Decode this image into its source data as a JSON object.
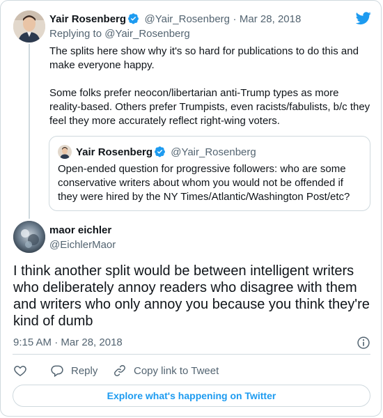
{
  "colors": {
    "accent": "#1d9bf0",
    "text": "#0f1419",
    "muted": "#536471",
    "border": "#cfd9de"
  },
  "icons": {
    "brand": "twitter-bird-icon",
    "verified": "verified-badge-icon",
    "info": "info-icon",
    "like": "heart-icon",
    "reply": "reply-bubble-icon",
    "copy_link": "link-icon"
  },
  "tweet": {
    "author": {
      "name": "Yair Rosenberg",
      "handle": "@Yair_Rosenberg"
    },
    "separator": "·",
    "date": "Mar 28, 2018",
    "replying_to_prefix": "Replying to",
    "replying_to_handle": "@Yair_Rosenberg",
    "paragraph_1": "The splits here show why it's so hard for publications to do this and make everyone happy.",
    "paragraph_2": "Some folks prefer neocon/libertarian anti-Trump types as more reality-based. Others prefer Trumpists, even racists/fabulists, b/c they feel they more accurately reflect right-wing voters.",
    "quoted": {
      "name": "Yair Rosenberg",
      "handle": "@Yair_Rosenberg",
      "text": "Open-ended question for progressive followers: who are some conservative writers about whom you would not be offended if they were hired by the NY Times/Atlantic/Washington Post/etc?"
    }
  },
  "reply": {
    "author": {
      "name": "maor eichler",
      "handle": "@EichlerMaor"
    },
    "text": "I think another split would be between intelligent writers who deliberately annoy readers who disagree with them and writers who only annoy you because you think they're kind of dumb",
    "timestamp": "9:15 AM · Mar 28, 2018"
  },
  "actions": {
    "reply_label": "Reply",
    "copy_link_label": "Copy link to Tweet"
  },
  "footer": {
    "explore_label": "Explore what's happening on Twitter"
  }
}
